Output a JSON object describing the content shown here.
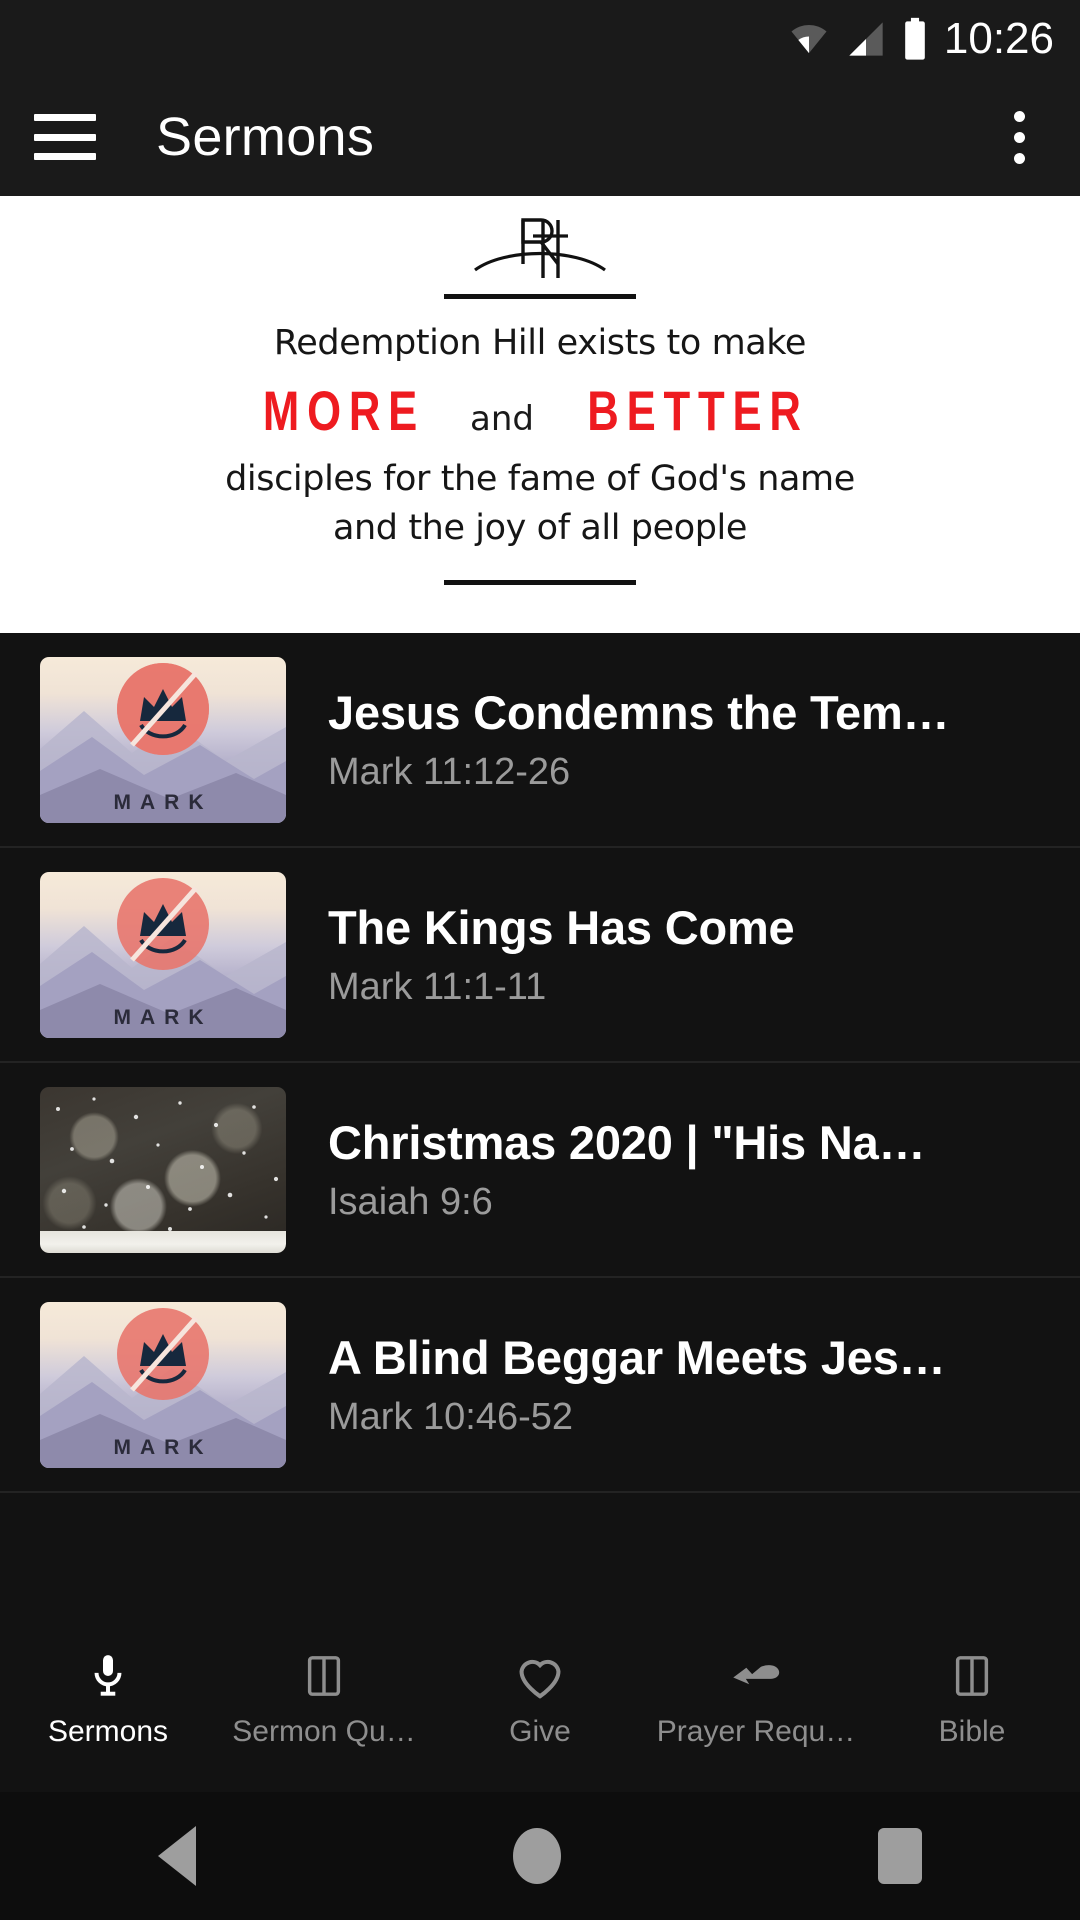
{
  "status_bar": {
    "time": "10:26",
    "icons": [
      "wifi-icon",
      "cell-signal-icon",
      "battery-icon"
    ]
  },
  "app_bar": {
    "menu_icon": "hamburger-menu-icon",
    "title": "Sermons",
    "overflow_icon": "more-vertical-icon"
  },
  "banner": {
    "logo_alt": "RH",
    "line1": "Redemption Hill exists to make",
    "more": "MORE",
    "and": "and",
    "better": "BETTER",
    "line3": "disciples for the fame of God's name",
    "line4": "and the joy of all people",
    "accent_color": "#ee1b20",
    "background_color": "#ffffff"
  },
  "sermons": [
    {
      "title": "Jesus Condemns the Tem…",
      "reference": "Mark 11:12-26",
      "artwork": "mark-series-artwork",
      "artwork_label": "MARK"
    },
    {
      "title": "The Kings Has Come",
      "reference": "Mark 11:1-11",
      "artwork": "mark-series-artwork",
      "artwork_label": "MARK"
    },
    {
      "title": "Christmas 2020 | \"His Na…",
      "reference": "Isaiah 9:6",
      "artwork": "christmas-snow-artwork",
      "artwork_label": ""
    },
    {
      "title": "A Blind Beggar Meets Jes…",
      "reference": "Mark 10:46-52",
      "artwork": "mark-series-artwork",
      "artwork_label": "MARK"
    }
  ],
  "tabs": [
    {
      "label": "Sermons",
      "icon": "microphone-icon",
      "active": true
    },
    {
      "label": "Sermon Qu…",
      "icon": "book-icon",
      "active": false
    },
    {
      "label": "Give",
      "icon": "heart-icon",
      "active": false
    },
    {
      "label": "Prayer Requ…",
      "icon": "praying-hands-icon",
      "active": false
    },
    {
      "label": "Bible",
      "icon": "book-icon",
      "active": false
    }
  ],
  "system_nav": {
    "back": "back-triangle-icon",
    "home": "home-circle-icon",
    "recents": "recents-square-icon"
  }
}
